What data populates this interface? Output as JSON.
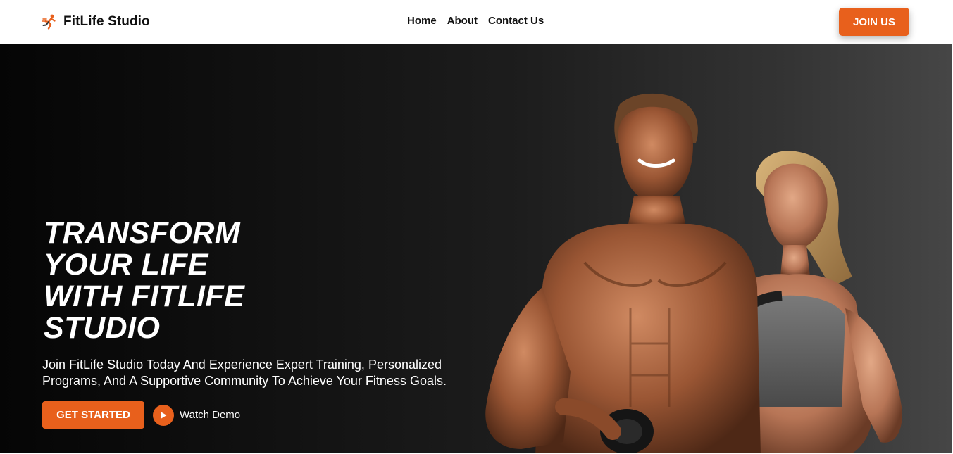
{
  "navbar": {
    "brand_name": "FitLife Studio",
    "brand_logo_icon": "running-figure-icon",
    "links": [
      {
        "label": "Home"
      },
      {
        "label": "About"
      },
      {
        "label": "Contact Us"
      }
    ],
    "join_button_label": "JOIN US"
  },
  "hero": {
    "title_lines": [
      "TRANSFORM",
      "YOUR LIFE",
      "WITH FITLIFE",
      "STUDIO"
    ],
    "subtitle": "Join FitLife Studio Today And Experience Expert Training, Personalized Programs, And A Supportive Community To Achieve Your Fitness Goals.",
    "get_started_label": "GET STARTED",
    "watch_demo_label": "Watch Demo",
    "play_icon": "play-icon"
  },
  "colors": {
    "accent": "#e8601c",
    "nav_bg": "#ffffff",
    "hero_bg_left": "#050505",
    "hero_bg_right": "#464646",
    "text_dark": "#111111",
    "text_light": "#ffffff"
  }
}
